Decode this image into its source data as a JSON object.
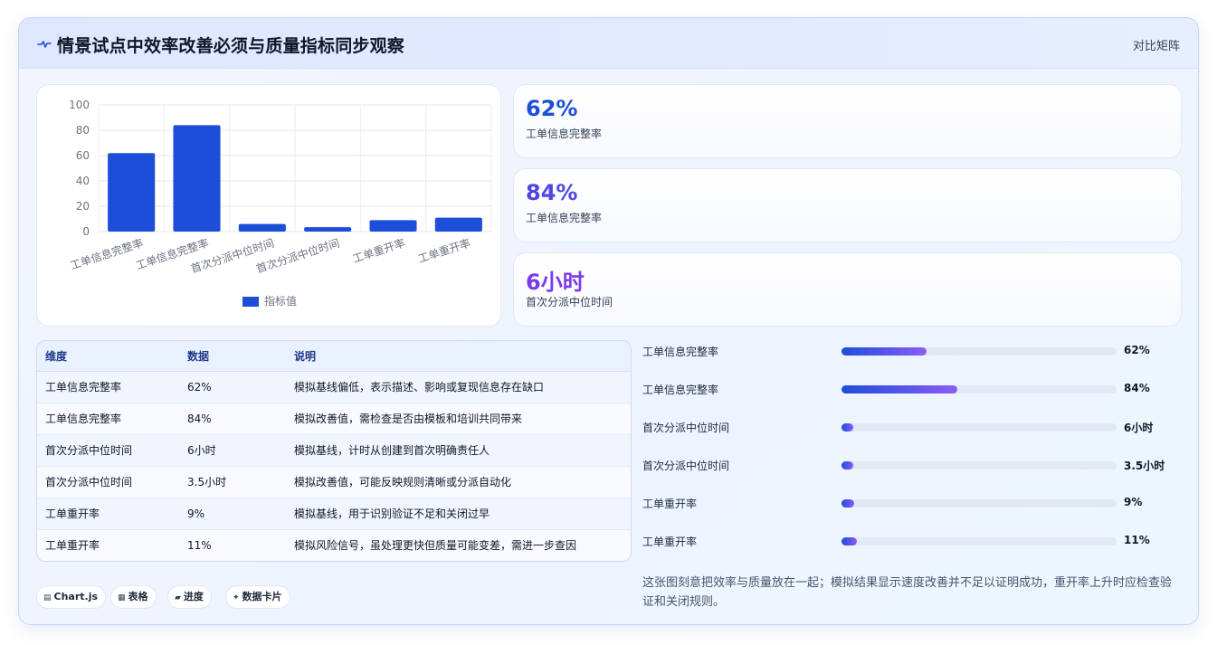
{
  "header": {
    "title": "情景试点中效率改善必须与质量指标同步观察",
    "tag": "对比矩阵",
    "logo_icon": "pulse-icon"
  },
  "chart_data": {
    "type": "bar",
    "categories": [
      "工单信息完整率",
      "工单信息完整率",
      "首次分派中位时间",
      "首次分派中位时间",
      "工单重开率",
      "工单重开率"
    ],
    "series": [
      {
        "name": "指标值",
        "values": [
          62,
          84,
          6,
          3.5,
          9,
          11
        ],
        "color": "#1d4ed8"
      }
    ],
    "yticks": [
      "0",
      "20",
      "40",
      "60",
      "80",
      "100"
    ],
    "ylim": [
      0,
      100
    ],
    "legend": "bottom",
    "grid": true
  },
  "stats": [
    {
      "value": "62%",
      "label": "工单信息完整率"
    },
    {
      "value": "84%",
      "label": "工单信息完整率"
    },
    {
      "value": "6小时",
      "label": "首次分派中位时间"
    }
  ],
  "table": {
    "headers": [
      "维度",
      "数据",
      "说明"
    ],
    "rows": [
      [
        "工单信息完整率",
        "62%",
        "模拟基线偏低，表示描述、影响或复现信息存在缺口"
      ],
      [
        "工单信息完整率",
        "84%",
        "模拟改善值，需检查是否由模板和培训共同带来"
      ],
      [
        "首次分派中位时间",
        "6小时",
        "模拟基线，计时从创建到首次明确责任人"
      ],
      [
        "首次分派中位时间",
        "3.5小时",
        "模拟改善值，可能反映规则清晰或分派自动化"
      ],
      [
        "工单重开率",
        "9%",
        "模拟基线，用于识别验证不足和关闭过早"
      ],
      [
        "工单重开率",
        "11%",
        "模拟风险信号，虽处理更快但质量可能变差，需进一步查因"
      ]
    ]
  },
  "progress": [
    {
      "label": "工单信息完整率",
      "value": "62%",
      "fraction": 0.31
    },
    {
      "label": "工单信息完整率",
      "value": "84%",
      "fraction": 0.42
    },
    {
      "label": "首次分派中位时间",
      "value": "6小时",
      "fraction": 0.03
    },
    {
      "label": "首次分派中位时间",
      "value": "3.5小时",
      "fraction": 0.02
    },
    {
      "label": "工单重开率",
      "value": "9%",
      "fraction": 0.045
    },
    {
      "label": "工单重开率",
      "value": "11%",
      "fraction": 0.055
    }
  ],
  "note": "这张图刻意把效率与质量放在一起；模拟结果显示速度改善并不足以证明成功，重开率上升时应检查验证和关闭规则。",
  "chips": [
    {
      "icon": "▤",
      "label": "Chart.js"
    },
    {
      "icon": "▦",
      "label": "表格"
    },
    {
      "icon": "▰",
      "label": "进度"
    },
    {
      "icon": "✦",
      "label": "数据卡片"
    }
  ]
}
